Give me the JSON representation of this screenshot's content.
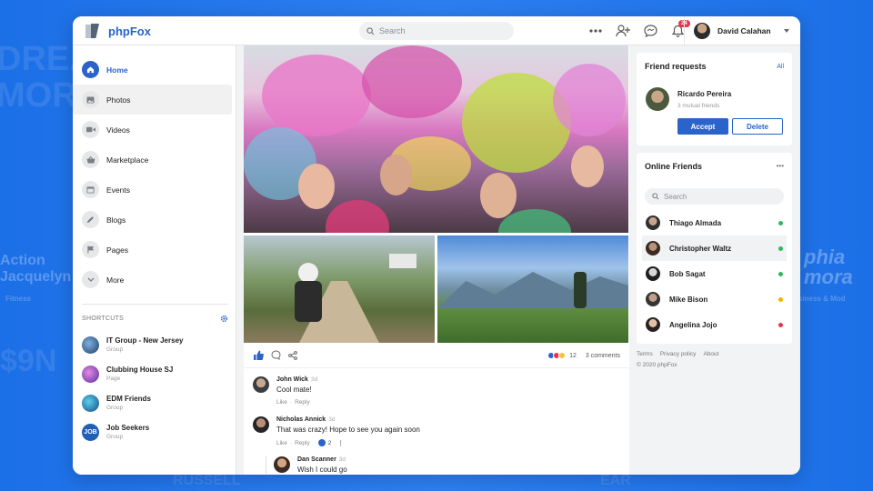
{
  "background": {
    "words": [
      "DREA",
      "MOR",
      "Action",
      "Jacquelyn",
      "Fitness",
      "$9N",
      "phia",
      "mora",
      "siness & Mod",
      "RUSSELL",
      "EAR"
    ]
  },
  "header": {
    "logo": "phpFox",
    "search_placeholder": "Search",
    "notification_count": "24",
    "user_name": "David Calahan"
  },
  "sidebar": {
    "items": [
      {
        "label": "Home",
        "icon": "home-icon"
      },
      {
        "label": "Photos",
        "icon": "photo-icon"
      },
      {
        "label": "Videos",
        "icon": "video-icon"
      },
      {
        "label": "Marketplace",
        "icon": "basket-icon"
      },
      {
        "label": "Events",
        "icon": "calendar-icon"
      },
      {
        "label": "Blogs",
        "icon": "pencil-icon"
      },
      {
        "label": "Pages",
        "icon": "flag-icon"
      },
      {
        "label": "More",
        "icon": "chevron-down-icon"
      }
    ],
    "shortcuts_title": "SHORTCUTS",
    "shortcuts": [
      {
        "name": "IT Group - New Jersey",
        "type": "Group"
      },
      {
        "name": "Clubbing House SJ",
        "type": "Page"
      },
      {
        "name": "EDM Friends",
        "type": "Group"
      },
      {
        "name": "Job Seekers",
        "type": "Group"
      }
    ]
  },
  "post": {
    "reaction_count": "12",
    "comments_count": "3 comments",
    "comments": [
      {
        "name": "John Wick",
        "time": "3d",
        "text": "Cool mate!",
        "like": "Like",
        "reply": "Reply"
      },
      {
        "name": "Nicholas Annick",
        "time": "3d",
        "text": "That was crazy! Hope to see you again soon",
        "like": "Like",
        "reply": "Reply",
        "reactions": "2"
      },
      {
        "name": "Dan Scanner",
        "time": "3d",
        "text": "Wish I could go"
      }
    ]
  },
  "friend_requests": {
    "title": "Friend requests",
    "all_link": "All",
    "name": "Ricardo Pereira",
    "mutual": "3 mutual friends",
    "accept": "Accept",
    "delete": "Delete"
  },
  "online_friends": {
    "title": "Online Friends",
    "more": "•••",
    "search_placeholder": "Search",
    "friends": [
      {
        "name": "Thiago Almada",
        "status_color": "#2eb85c"
      },
      {
        "name": "Christopher Waltz",
        "status_color": "#2eb85c"
      },
      {
        "name": "Bob Sagat",
        "status_color": "#2eb85c"
      },
      {
        "name": "Mike Bison",
        "status_color": "#f0b400"
      },
      {
        "name": "Angelina Jojo",
        "status_color": "#e8334a"
      }
    ]
  },
  "footer": {
    "links": [
      "Terms",
      "Privacy policy",
      "About"
    ],
    "copyright": "© 2020 phpFox"
  },
  "colors": {
    "accent": "#2a63c9",
    "background": "#1a73e8"
  }
}
